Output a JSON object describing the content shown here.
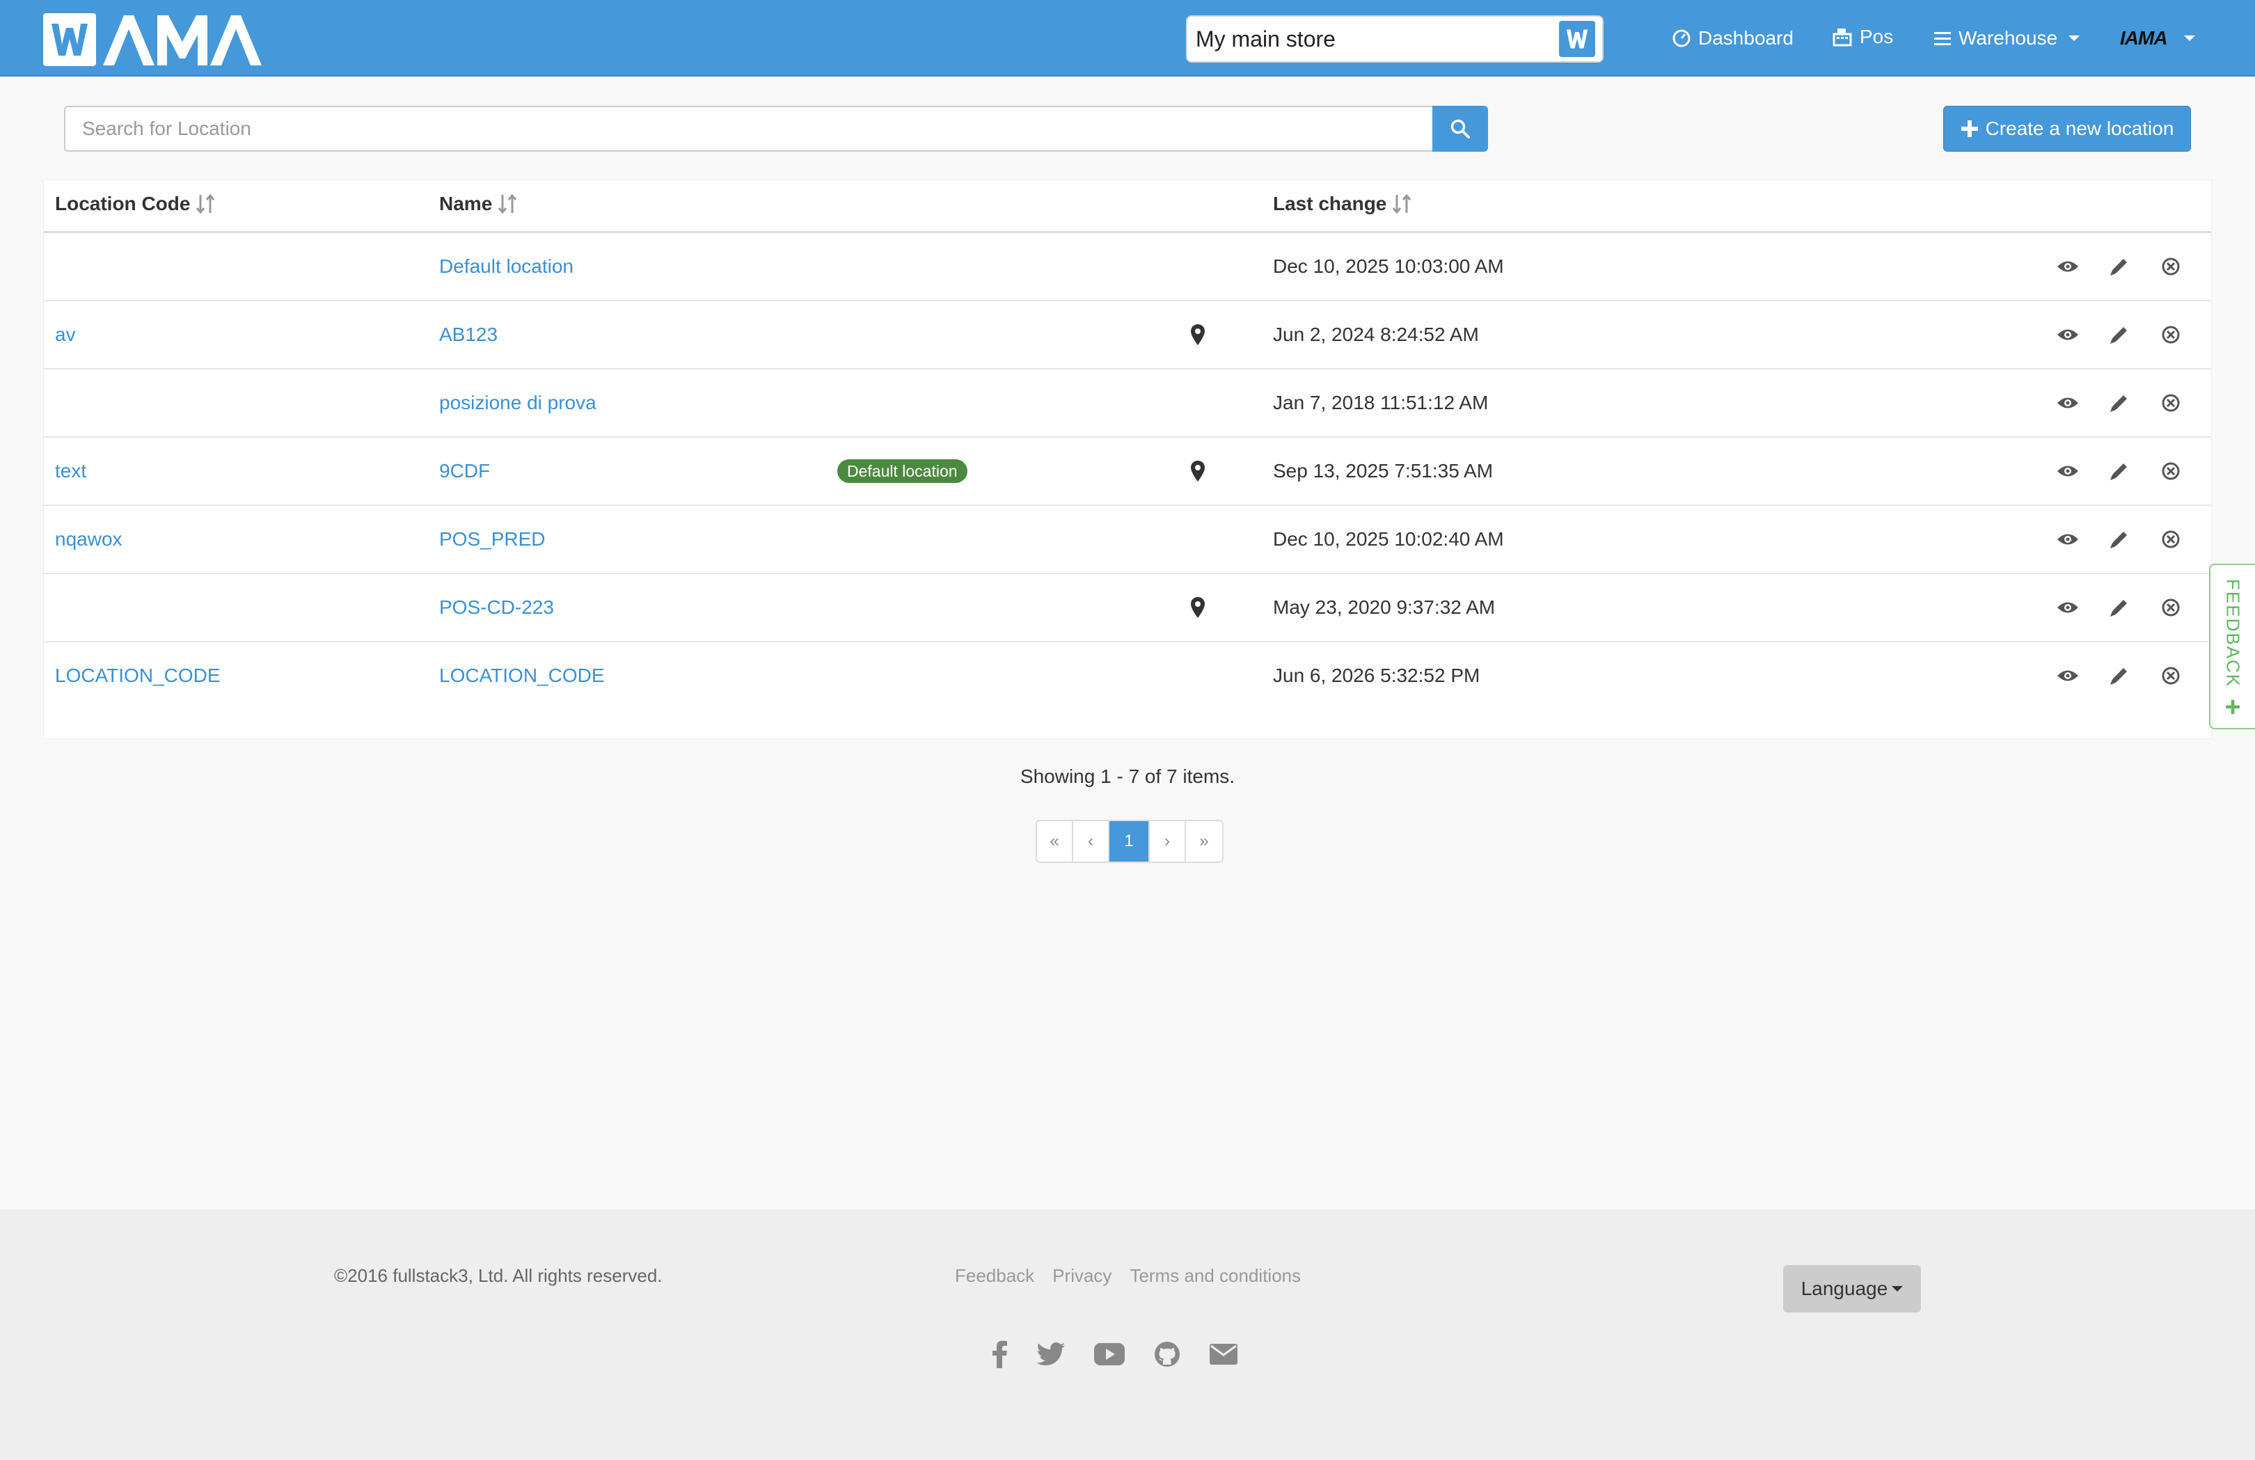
{
  "brand": {
    "name": "WAMA"
  },
  "header": {
    "store_name": "My main store",
    "nav": {
      "dashboard": "Dashboard",
      "pos": "Pos",
      "warehouse": "Warehouse",
      "user_logo": "IAMA"
    }
  },
  "toolbar": {
    "search_placeholder": "Search for Location",
    "create_label": "Create a new location"
  },
  "table": {
    "columns": {
      "location_code": "Location Code",
      "name": "Name",
      "last_change": "Last change"
    },
    "rows": [
      {
        "code": "",
        "name": "Default location",
        "badge": "",
        "pin": false,
        "date": "Dec 10, 2025 10:03:00 AM"
      },
      {
        "code": "av",
        "name": "AB123",
        "badge": "",
        "pin": true,
        "date": "Jun 2, 2024 8:24:52 AM"
      },
      {
        "code": "",
        "name": "posizione di prova",
        "badge": "",
        "pin": false,
        "date": "Jan 7, 2018 11:51:12 AM"
      },
      {
        "code": "text",
        "name": "9CDF",
        "badge": "Default location",
        "pin": true,
        "date": "Sep 13, 2025 7:51:35 AM"
      },
      {
        "code": "nqawox",
        "name": "POS_PRED",
        "badge": "",
        "pin": false,
        "date": "Dec 10, 2025 10:02:40 AM"
      },
      {
        "code": "",
        "name": "POS-CD-223",
        "badge": "",
        "pin": true,
        "date": "May 23, 2020 9:37:32 AM"
      },
      {
        "code": "LOCATION_CODE",
        "name": "LOCATION_CODE",
        "badge": "",
        "pin": false,
        "date": "Jun 6, 2026 5:32:52 PM"
      }
    ]
  },
  "summary": {
    "showing": "Showing 1 - 7 of 7 items."
  },
  "pagination": {
    "first": "«",
    "prev": "‹",
    "current": "1",
    "next": "›",
    "last": "»"
  },
  "feedback_tab": {
    "label": "FEEDBACK",
    "plus": "+"
  },
  "footer": {
    "copyright": "©2016 fullstack3, Ltd. All rights reserved.",
    "links": [
      "Feedback",
      "Privacy",
      "Terms and conditions"
    ],
    "language_label": "Language",
    "socials": [
      "facebook-icon",
      "twitter-icon",
      "youtube-icon",
      "github-icon",
      "envelope-icon"
    ]
  },
  "colors": {
    "primary": "#4598da",
    "link": "#3a8fd6",
    "badge_green": "#4b8a3e",
    "feedback_green": "#5cb85c",
    "footer_bg": "#eeeeee"
  }
}
